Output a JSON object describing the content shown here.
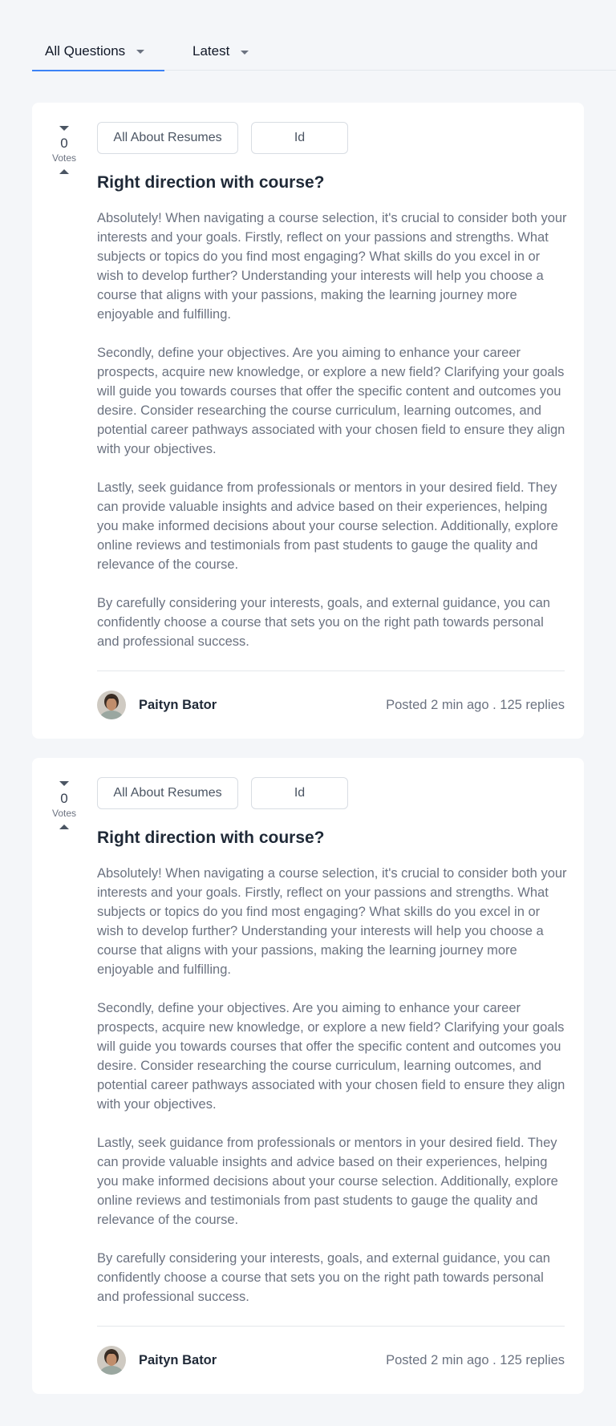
{
  "filters": {
    "category": {
      "label": "All Questions"
    },
    "sort": {
      "label": "Latest"
    }
  },
  "accent_color": "#3b82f6",
  "posts": [
    {
      "votes": "0",
      "votes_label": "Votes",
      "tags": [
        "All About Resumes",
        "Id"
      ],
      "title": "Right direction with course?",
      "paragraphs": [
        "Absolutely! When navigating a course selection, it's crucial to consider both your interests and your goals. Firstly, reflect on your passions and strengths. What subjects or topics do you find most engaging? What skills do you excel in or wish to develop further? Understanding your interests will help you choose a course that aligns with your passions, making the learning journey more enjoyable and fulfilling.",
        "Secondly, define your objectives. Are you aiming to enhance your career prospects, acquire new knowledge, or explore a new field? Clarifying your goals will guide you towards courses that offer the specific content and outcomes you desire. Consider researching the course curriculum, learning outcomes, and potential career pathways associated with your chosen field to ensure they align with your objectives.",
        "Lastly, seek guidance from professionals or mentors in your desired field. They can provide valuable insights and advice based on their experiences, helping you make informed decisions about your course selection. Additionally, explore online reviews and testimonials from past students to gauge the quality and relevance of the course.",
        "By carefully considering your interests, goals, and external guidance, you can confidently choose a course that sets you on the right path towards personal and professional success."
      ],
      "author": "Paityn Bator",
      "meta": "Posted 2 min ago . 125 replies"
    },
    {
      "votes": "0",
      "votes_label": "Votes",
      "tags": [
        "All About Resumes",
        "Id"
      ],
      "title": "Right direction with course?",
      "paragraphs": [
        "Absolutely! When navigating a course selection, it's crucial to consider both your interests and your goals. Firstly, reflect on your passions and strengths. What subjects or topics do you find most engaging? What skills do you excel in or wish to develop further? Understanding your interests will help you choose a course that aligns with your passions, making the learning journey more enjoyable and fulfilling.",
        "Secondly, define your objectives. Are you aiming to enhance your career prospects, acquire new knowledge, or explore a new field? Clarifying your goals will guide you towards courses that offer the specific content and outcomes you desire. Consider researching the course curriculum, learning outcomes, and potential career pathways associated with your chosen field to ensure they align with your objectives.",
        "Lastly, seek guidance from professionals or mentors in your desired field. They can provide valuable insights and advice based on their experiences, helping you make informed decisions about your course selection. Additionally, explore online reviews and testimonials from past students to gauge the quality and relevance of the course.",
        "By carefully considering your interests, goals, and external guidance, you can confidently choose a course that sets you on the right path towards personal and professional success."
      ],
      "author": "Paityn Bator",
      "meta": "Posted 2 min ago . 125 replies"
    }
  ]
}
